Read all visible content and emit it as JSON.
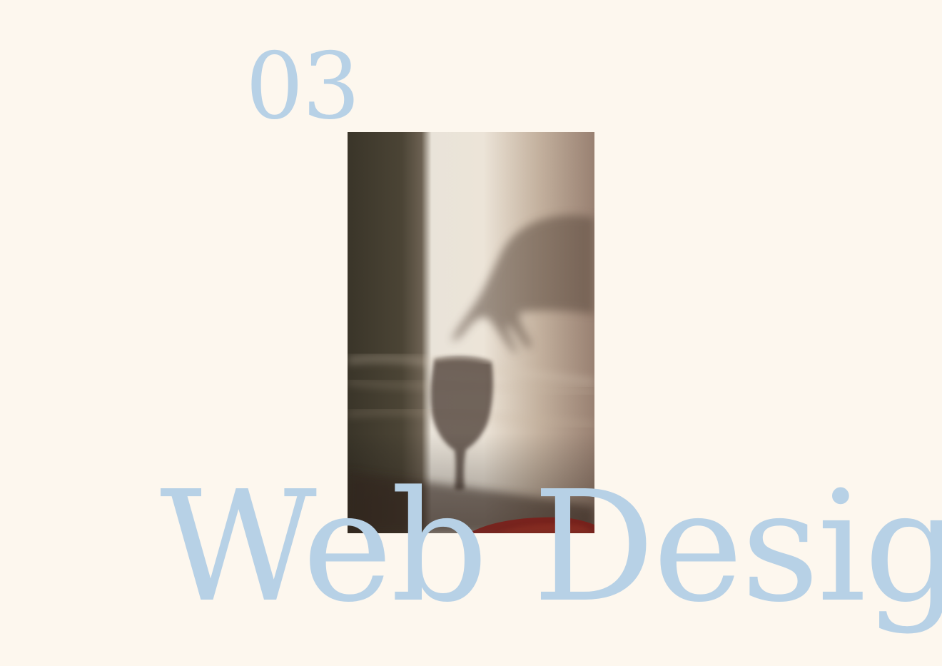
{
  "section": {
    "number": "03",
    "title": "Web Design"
  },
  "photo": {
    "subject": "shadow-of-hand-and-wine-glass"
  },
  "colors": {
    "background": "#fdf7ee",
    "accent": "#b7d1e6"
  }
}
